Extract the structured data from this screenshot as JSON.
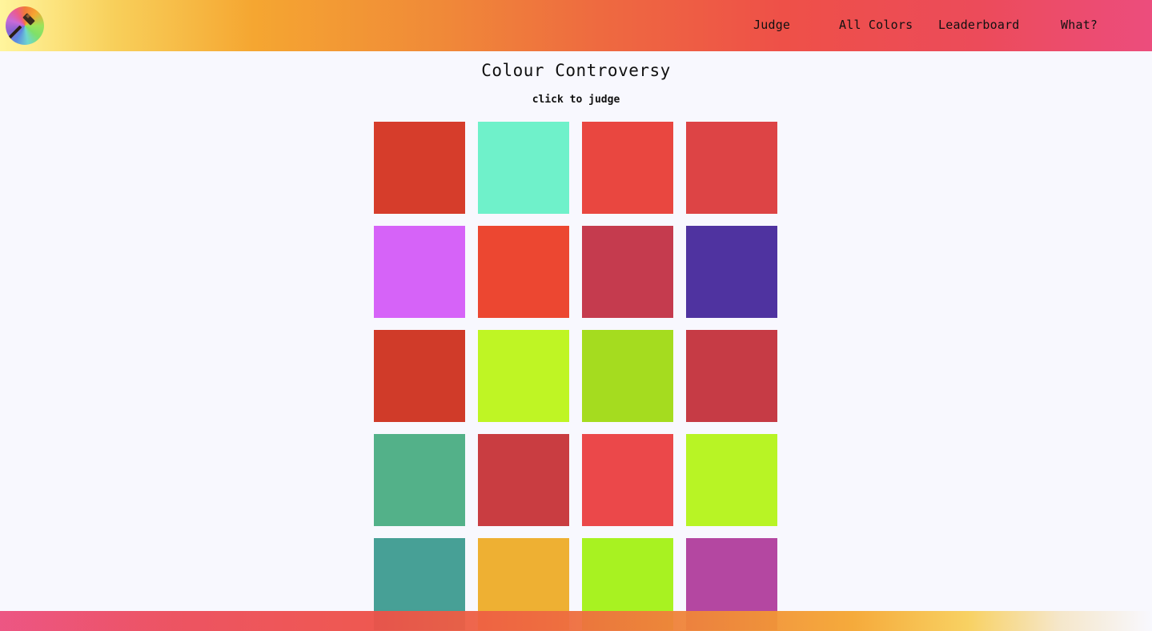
{
  "nav": {
    "judge": "Judge",
    "all_colors": "All Colors",
    "leaderboard": "Leaderboard",
    "what": "What?"
  },
  "page": {
    "title": "Colour Controversy",
    "subtitle": "click to judge"
  },
  "logo": {
    "icon": "gavel-color-wheel-icon"
  },
  "swatches": [
    "#d63d2b",
    "#6ff1ca",
    "#e94740",
    "#dd4445",
    "#d663f8",
    "#ec4731",
    "#c53b4e",
    "#4f33a0",
    "#d03b29",
    "#bff524",
    "#a5dc1f",
    "#c63b45",
    "#53b189",
    "#c93d41",
    "#eb484a",
    "#b8f425",
    "#47a096",
    "#eeb033",
    "#a8f221",
    "#b447a1"
  ]
}
